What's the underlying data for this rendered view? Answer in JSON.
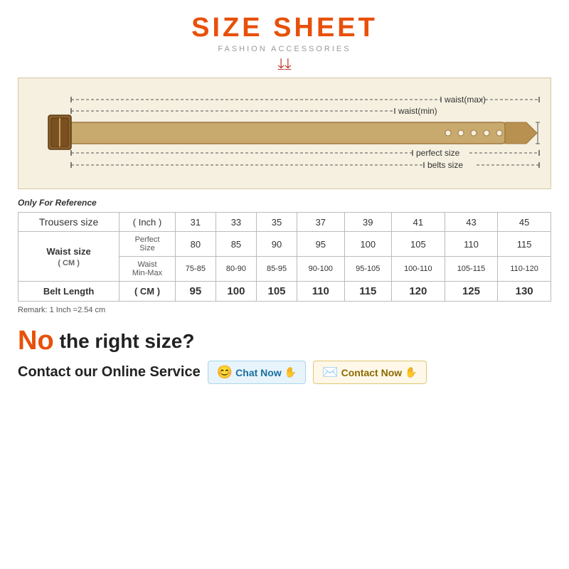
{
  "page": {
    "title": "SIZE SHEET",
    "subtitle": "FASHION ACCESSORIES",
    "reference_note": "Only For Reference",
    "remark": "Remark: 1 Inch =2.54 cm",
    "no_text": "No",
    "right_size_question": "the right size?",
    "contact_label": "Contact our Online Service",
    "chat_btn": "Chat Now",
    "contact_btn": "Contact Now"
  },
  "table": {
    "headers": {
      "trousers": "Trousers size",
      "inch": "( Inch )",
      "sizes": [
        "31",
        "33",
        "35",
        "37",
        "39",
        "41",
        "43",
        "45"
      ]
    },
    "waist_row": {
      "main_label": "Waist size",
      "unit_label": "( CM )",
      "perfect_label": "Perfect",
      "perfect_label2": "Size",
      "perfect_values": [
        "80",
        "85",
        "90",
        "95",
        "100",
        "105",
        "110",
        "115"
      ],
      "minmax_label": "Waist",
      "minmax_label2": "Min-Max",
      "minmax_values": [
        "75-85",
        "80-90",
        "85-95",
        "90-100",
        "95-105",
        "100-110",
        "105-115",
        "110-120"
      ]
    },
    "belt_row": {
      "label": "Belt Length",
      "unit": "( CM )",
      "values": [
        "95",
        "100",
        "105",
        "110",
        "115",
        "120",
        "125",
        "130"
      ]
    }
  }
}
